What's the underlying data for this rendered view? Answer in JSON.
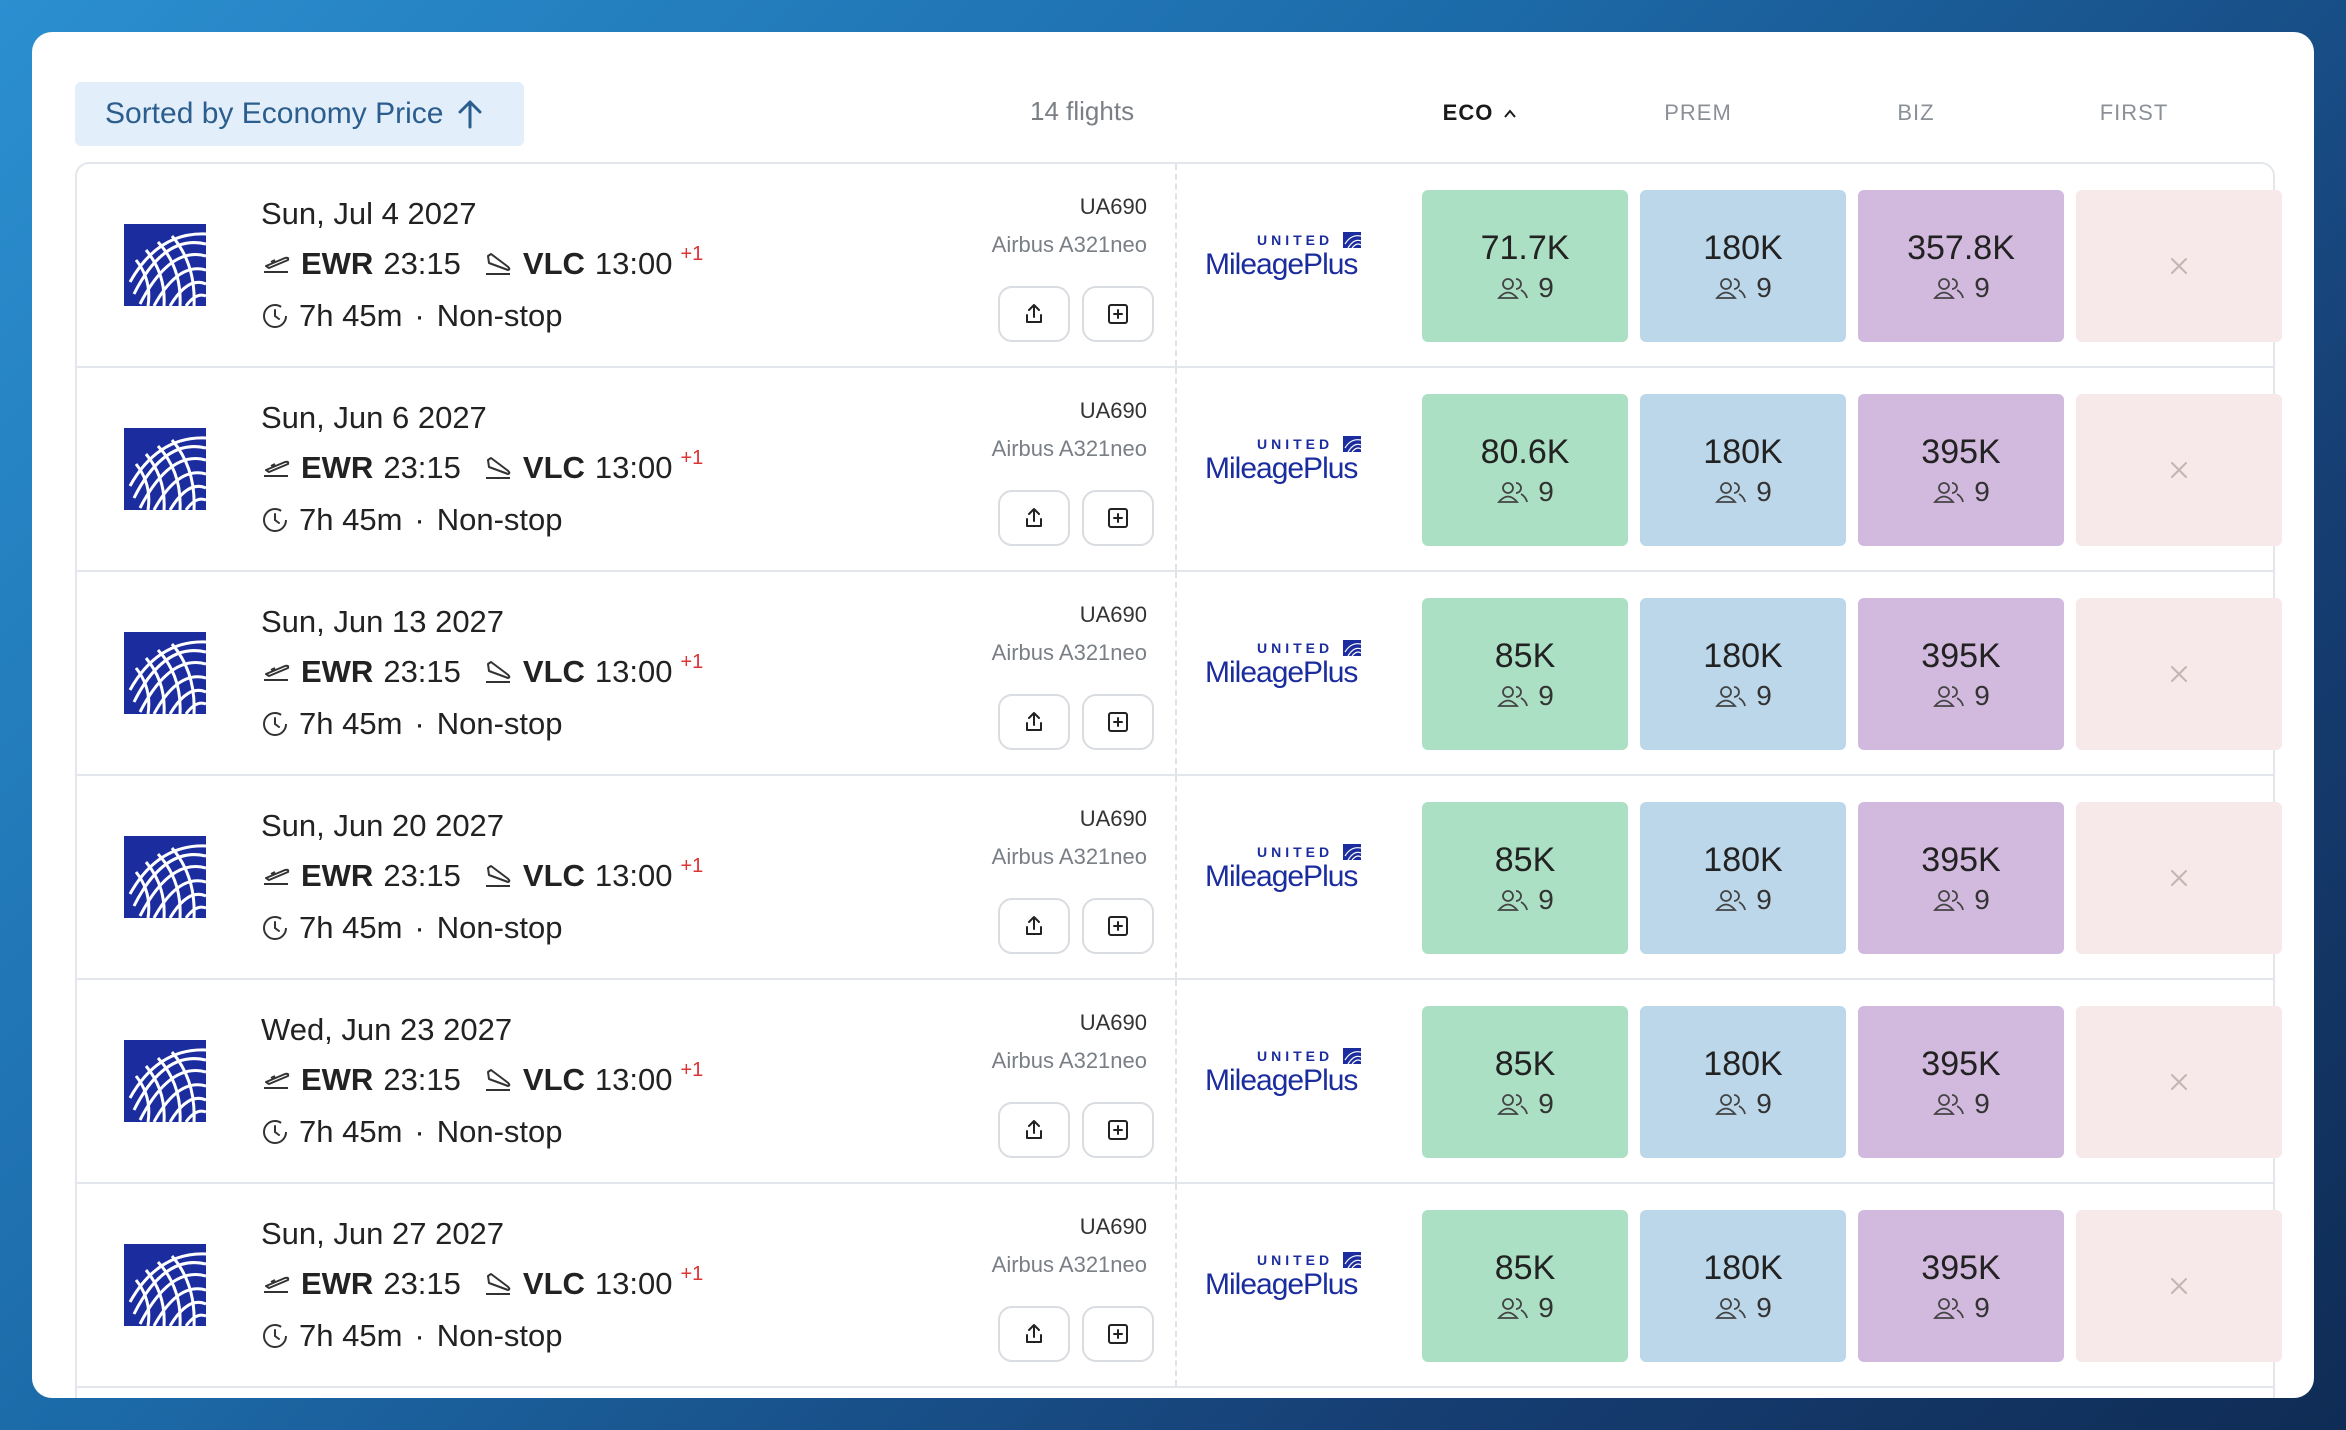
{
  "header": {
    "sort_label": "Sorted by Economy Price",
    "count": "14 flights",
    "columns": {
      "eco": "ECO",
      "prem": "PREM",
      "biz": "BIZ",
      "first": "FIRST"
    }
  },
  "colors": {
    "eco": "#abe0c5",
    "prem": "#bcd7ea",
    "biz": "#d2b9de",
    "first": "#f7e9e9",
    "united_blue": "#1b2d9e",
    "next_day": "#dd3333"
  },
  "program": {
    "brand_top": "UNITED",
    "brand_main": "MileagePlus"
  },
  "icons": [
    "united-globe-icon",
    "takeoff-icon",
    "landing-icon",
    "clock-icon",
    "share-icon",
    "add-icon",
    "passengers-icon",
    "close-icon",
    "arrow-up-icon",
    "chevron-up-icon"
  ],
  "flights": [
    {
      "date": "Sun, Jul 4 2027",
      "dep_code": "EWR",
      "dep_time": "23:15",
      "arr_code": "VLC",
      "arr_time": "13:00",
      "next_day": "+1",
      "duration": "7h 45m",
      "stops": "Non-stop",
      "separator": "·",
      "flight_no": "UA690",
      "aircraft": "Airbus A321neo",
      "eco": "71.7K",
      "eco_seats": "9",
      "prem": "180K",
      "prem_seats": "9",
      "biz": "357.8K",
      "biz_seats": "9"
    },
    {
      "date": "Sun, Jun 6 2027",
      "dep_code": "EWR",
      "dep_time": "23:15",
      "arr_code": "VLC",
      "arr_time": "13:00",
      "next_day": "+1",
      "duration": "7h 45m",
      "stops": "Non-stop",
      "separator": "·",
      "flight_no": "UA690",
      "aircraft": "Airbus A321neo",
      "eco": "80.6K",
      "eco_seats": "9",
      "prem": "180K",
      "prem_seats": "9",
      "biz": "395K",
      "biz_seats": "9"
    },
    {
      "date": "Sun, Jun 13 2027",
      "dep_code": "EWR",
      "dep_time": "23:15",
      "arr_code": "VLC",
      "arr_time": "13:00",
      "next_day": "+1",
      "duration": "7h 45m",
      "stops": "Non-stop",
      "separator": "·",
      "flight_no": "UA690",
      "aircraft": "Airbus A321neo",
      "eco": "85K",
      "eco_seats": "9",
      "prem": "180K",
      "prem_seats": "9",
      "biz": "395K",
      "biz_seats": "9"
    },
    {
      "date": "Sun, Jun 20 2027",
      "dep_code": "EWR",
      "dep_time": "23:15",
      "arr_code": "VLC",
      "arr_time": "13:00",
      "next_day": "+1",
      "duration": "7h 45m",
      "stops": "Non-stop",
      "separator": "·",
      "flight_no": "UA690",
      "aircraft": "Airbus A321neo",
      "eco": "85K",
      "eco_seats": "9",
      "prem": "180K",
      "prem_seats": "9",
      "biz": "395K",
      "biz_seats": "9"
    },
    {
      "date": "Wed, Jun 23 2027",
      "dep_code": "EWR",
      "dep_time": "23:15",
      "arr_code": "VLC",
      "arr_time": "13:00",
      "next_day": "+1",
      "duration": "7h 45m",
      "stops": "Non-stop",
      "separator": "·",
      "flight_no": "UA690",
      "aircraft": "Airbus A321neo",
      "eco": "85K",
      "eco_seats": "9",
      "prem": "180K",
      "prem_seats": "9",
      "biz": "395K",
      "biz_seats": "9"
    },
    {
      "date": "Sun, Jun 27 2027",
      "dep_code": "EWR",
      "dep_time": "23:15",
      "arr_code": "VLC",
      "arr_time": "13:00",
      "next_day": "+1",
      "duration": "7h 45m",
      "stops": "Non-stop",
      "separator": "·",
      "flight_no": "UA690",
      "aircraft": "Airbus A321neo",
      "eco": "85K",
      "eco_seats": "9",
      "prem": "180K",
      "prem_seats": "9",
      "biz": "395K",
      "biz_seats": "9"
    }
  ]
}
